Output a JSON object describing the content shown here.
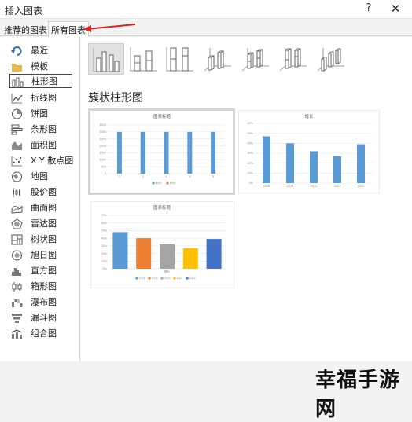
{
  "window": {
    "title": "插入图表",
    "help_label": "?",
    "close_label": "✕"
  },
  "tabs": [
    {
      "label": "推荐的图表",
      "active": false
    },
    {
      "label": "所有图表",
      "active": true
    }
  ],
  "annotation": {
    "arrow_color": "#e0201b"
  },
  "categories": [
    {
      "label": "最近",
      "icon": "recent-icon"
    },
    {
      "label": "模板",
      "icon": "folder-icon"
    },
    {
      "label": "柱形图",
      "icon": "column-chart-icon",
      "selected": true
    },
    {
      "label": "折线图",
      "icon": "line-chart-icon"
    },
    {
      "label": "饼图",
      "icon": "pie-chart-icon"
    },
    {
      "label": "条形图",
      "icon": "bar-chart-icon"
    },
    {
      "label": "面积图",
      "icon": "area-chart-icon"
    },
    {
      "label": "X Y 散点图",
      "icon": "scatter-chart-icon"
    },
    {
      "label": "地图",
      "icon": "map-chart-icon"
    },
    {
      "label": "股价图",
      "icon": "stock-chart-icon"
    },
    {
      "label": "曲面图",
      "icon": "surface-chart-icon"
    },
    {
      "label": "雷达图",
      "icon": "radar-chart-icon"
    },
    {
      "label": "树状图",
      "icon": "treemap-chart-icon"
    },
    {
      "label": "旭日图",
      "icon": "sunburst-chart-icon"
    },
    {
      "label": "直方图",
      "icon": "histogram-chart-icon"
    },
    {
      "label": "箱形图",
      "icon": "box-whisker-chart-icon"
    },
    {
      "label": "瀑布图",
      "icon": "waterfall-chart-icon"
    },
    {
      "label": "漏斗图",
      "icon": "funnel-chart-icon"
    },
    {
      "label": "组合图",
      "icon": "combo-chart-icon"
    }
  ],
  "main": {
    "section_title": "簇状柱形图"
  },
  "chart_data": [
    {
      "type": "bar",
      "title": "图表标题",
      "categories": [
        "1",
        "2",
        "3",
        "4",
        "5"
      ],
      "series": [
        {
          "values": [
            3000,
            3000,
            3000,
            3000,
            3000
          ],
          "color": "#5b9bd5"
        },
        {
          "values": [
            0,
            0,
            0,
            0,
            0
          ],
          "color": "#ed7d31"
        }
      ],
      "yticks": [
        "3500",
        "3000",
        "2500",
        "2000",
        "1500",
        "1000",
        "500",
        "0"
      ],
      "ylim": [
        0,
        3500
      ],
      "legend": [
        "系列1",
        "系列2"
      ],
      "legend_position": "bottom"
    },
    {
      "type": "bar",
      "title": "增长",
      "categories": [
        "2018",
        "2019",
        "2020",
        "2021",
        "2022"
      ],
      "series": [
        {
          "values": [
            0.47,
            0.4,
            0.32,
            0.27,
            0.39
          ],
          "color": "#5b9bd5"
        }
      ],
      "yticks": [
        "60%",
        "50%",
        "40%",
        "30%",
        "20%",
        "10%",
        "0%"
      ],
      "ylim": [
        0,
        0.6
      ]
    },
    {
      "type": "bar",
      "title": "图表标题",
      "categories": [
        "2018",
        "2019",
        "2020",
        "2021",
        "2022"
      ],
      "values": [
        0.48,
        0.4,
        0.32,
        0.27,
        0.39
      ],
      "colors": [
        "#5b9bd5",
        "#ed7d31",
        "#a5a5a5",
        "#ffc000",
        "#4472c4"
      ],
      "yticks": [
        "70%",
        "60%",
        "50%",
        "40%",
        "30%",
        "20%",
        "10%",
        "0%"
      ],
      "ylim": [
        0,
        0.7
      ],
      "xlabel": "增长",
      "legend": [
        "2018",
        "2019",
        "2020",
        "2021",
        "2022"
      ],
      "legend_position": "bottom"
    }
  ],
  "watermark": {
    "text": "幸福手游网"
  }
}
